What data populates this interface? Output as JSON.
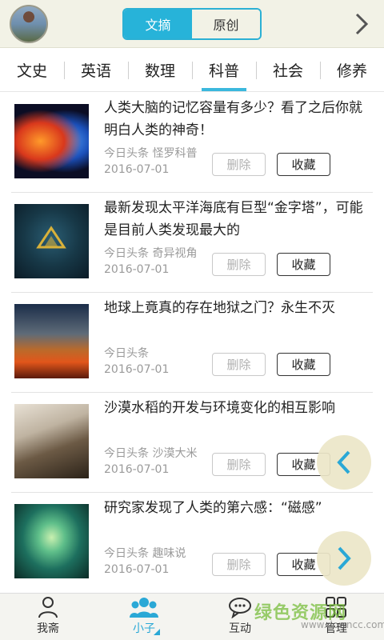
{
  "header": {
    "segments": [
      "文摘",
      "原创"
    ],
    "active_segment": 0
  },
  "tabs": [
    "文史",
    "英语",
    "数理",
    "科普",
    "社会",
    "修养"
  ],
  "active_tab": 3,
  "articles": [
    {
      "title": "人类大脑的记忆容量有多少？看了之后你就明白人类的神奇！",
      "source": "今日头条 怪罗科普",
      "date": "2016-07-01",
      "delete_label": "删除",
      "fav_label": "收藏"
    },
    {
      "title": "最新发现太平洋海底有巨型“金字塔”，可能是目前人类发现最大的",
      "source": "今日头条 奇异视角",
      "date": "2016-07-01",
      "delete_label": "删除",
      "fav_label": "收藏"
    },
    {
      "title": "地球上竟真的存在地狱之门？永生不灭",
      "source": "今日头条",
      "date": "2016-07-01",
      "delete_label": "删除",
      "fav_label": "收藏"
    },
    {
      "title": "沙漠水稻的开发与环境变化的相互影响",
      "source": "今日头条 沙漠大米",
      "date": "2016-07-01",
      "delete_label": "删除",
      "fav_label": "收藏"
    },
    {
      "title": "研究家发现了人类的第六感：“磁感”",
      "source": "今日头条 趣味说",
      "date": "2016-07-01",
      "delete_label": "删除",
      "fav_label": "收藏"
    }
  ],
  "bottom_nav": [
    {
      "label": "我斋",
      "icon": "person-icon"
    },
    {
      "label": "小子",
      "icon": "group-icon"
    },
    {
      "label": "互动",
      "icon": "chat-icon"
    },
    {
      "label": "管理",
      "icon": "grid-icon"
    }
  ],
  "active_nav": 1,
  "watermark": {
    "text": "绿色资源网",
    "url": "www.downcc.com"
  },
  "colors": {
    "accent": "#27b3d9",
    "header_bg": "#f2f2e6",
    "watermark": "#78be3c"
  }
}
